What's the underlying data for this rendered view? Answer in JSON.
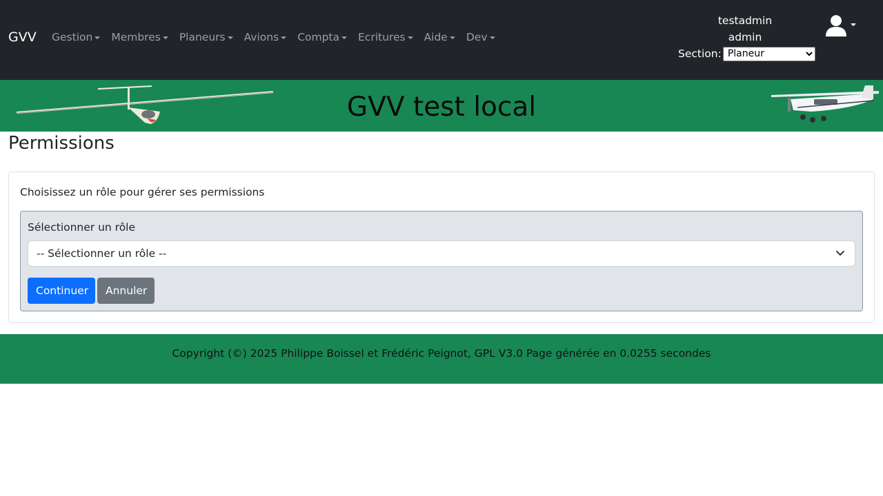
{
  "navbar": {
    "brand": "GVV",
    "menus": [
      {
        "label": "Gestion"
      },
      {
        "label": "Membres"
      },
      {
        "label": "Planeurs"
      },
      {
        "label": "Avions"
      },
      {
        "label": "Compta"
      },
      {
        "label": "Ecritures"
      },
      {
        "label": "Aide"
      },
      {
        "label": "Dev"
      }
    ],
    "username": "testadmin",
    "role": "admin",
    "section_label": "Section:",
    "section_value": "Planeur",
    "user_icon": "user-icon"
  },
  "banner": {
    "title": "GVV test local",
    "left_image": "glider",
    "right_image": "airplane"
  },
  "main": {
    "page_title": "Permissions",
    "intro": "Choisissez un rôle pour gérer ses permissions",
    "role_label": "Sélectionner un rôle",
    "role_select_value": "-- Sélectionner un rôle --",
    "continue_label": "Continuer",
    "cancel_label": "Annuler"
  },
  "footer": {
    "text": "Copyright (©) 2025 Philippe Boissel et Frédéric Peignot, GPL V3.0 Page générée en 0.0255 secondes"
  },
  "colors": {
    "navbar_bg": "#212529",
    "banner_bg": "#198754",
    "primary": "#0d6efd",
    "secondary": "#6c757d"
  }
}
